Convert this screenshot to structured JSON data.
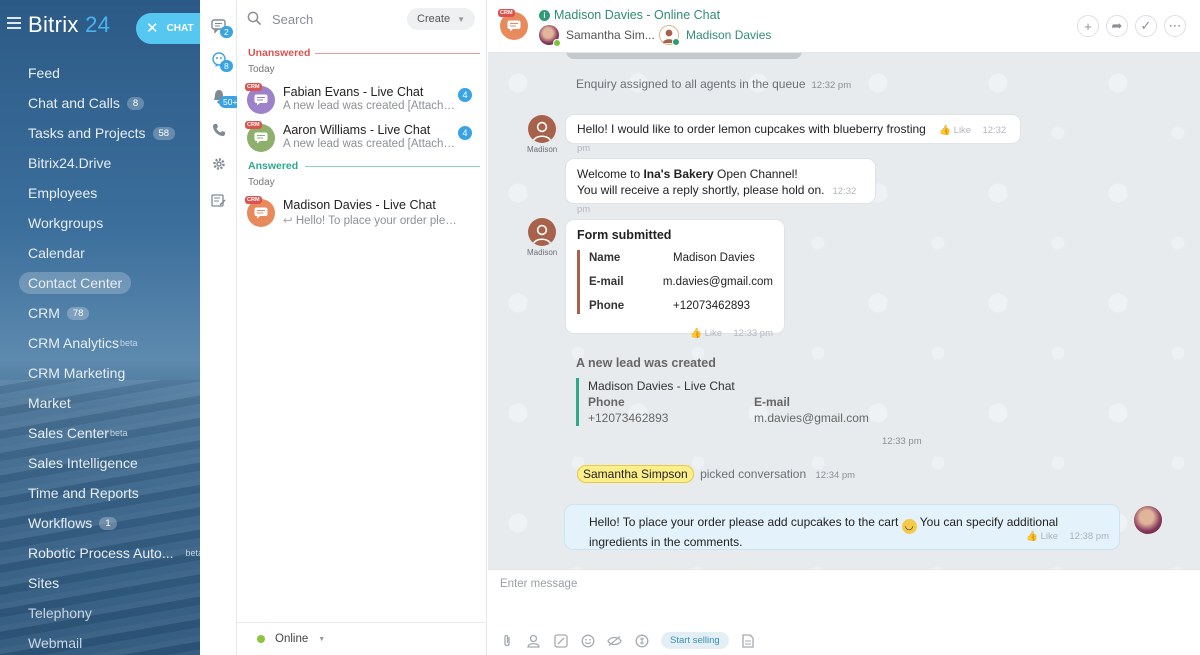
{
  "brand": {
    "name": "Bitrix",
    "number": "24"
  },
  "chat_button": "CHAT",
  "menu": [
    {
      "label": "Feed"
    },
    {
      "label": "Chat and Calls",
      "count": "8"
    },
    {
      "label": "Tasks and Projects",
      "count": "58"
    },
    {
      "label": "Bitrix24.Drive"
    },
    {
      "label": "Employees"
    },
    {
      "label": "Workgroups"
    },
    {
      "label": "Calendar"
    },
    {
      "label": "Contact Center"
    },
    {
      "label": "CRM",
      "count": "78"
    },
    {
      "label": "CRM Analytics",
      "sup": "beta"
    },
    {
      "label": "CRM Marketing"
    },
    {
      "label": "Market"
    },
    {
      "label": "Sales Center",
      "sup": "beta"
    },
    {
      "label": "Sales Intelligence"
    },
    {
      "label": "Time and Reports"
    },
    {
      "label": "Workflows",
      "count": "1"
    },
    {
      "label": "Robotic Process Auto...",
      "sup": "beta"
    },
    {
      "label": "Sites"
    },
    {
      "label": "Telephony"
    },
    {
      "label": "Webmail"
    }
  ],
  "rail": {
    "chats_badge": "2",
    "openlines_badge": "8",
    "notify_badge": "50+"
  },
  "recent": {
    "search_placeholder": "Search",
    "create_label": "Create",
    "unanswered_label": "Unanswered",
    "answered_label": "Answered",
    "today_label": "Today",
    "crm_tag": "CRM",
    "items": [
      {
        "name": "Fabian Evans - Live Chat",
        "snippet": "A new lead was created [Attachm...",
        "count": "4"
      },
      {
        "name": "Aaron Williams - Live Chat",
        "snippet": "A new lead was created [Attachm...",
        "count": "4"
      },
      {
        "name": "Madison Davies - Live Chat",
        "snippet": "Hello! To place your order please ..."
      }
    ],
    "status": "Online"
  },
  "header": {
    "title": "Madison Davies - Online Chat",
    "operator": "Samantha Sim...",
    "client": "Madison Davies"
  },
  "messages": {
    "queue_text": "Enquiry assigned to all agents in the queue",
    "queue_time": "12:32 pm",
    "client_caption": "Madison",
    "msg1": "Hello! I would like to order lemon cupcakes with blueberry frosting",
    "msg1_like": "Like",
    "msg1_time": "12:32 pm",
    "welcome_pre": "Welcome to ",
    "welcome_bold": "Ina's Bakery",
    "welcome_post": " Open Channel!",
    "welcome_line2": "You will receive a reply shortly, please hold on.",
    "welcome_time": "12:32 pm",
    "form_title": "Form submitted",
    "form": [
      {
        "key": "Name",
        "value": "Madison Davies"
      },
      {
        "key": "E-mail",
        "value": "m.davies@gmail.com"
      },
      {
        "key": "Phone",
        "value": "+12073462893"
      }
    ],
    "form_like": "Like",
    "form_time": "12:33 pm",
    "lead_title": "A new lead was created",
    "lead_name": "Madison Davies - Live Chat",
    "lead_phone_label": "Phone",
    "lead_phone": "+12073462893",
    "lead_email_label": "E-mail",
    "lead_email": "m.davies@gmail.com",
    "lead_time": "12:33 pm",
    "picked_name": "Samantha Simpson",
    "picked_text": "picked conversation",
    "picked_time": "12:34 pm",
    "reply_1": "Hello! To place your order please add cupcakes to the cart",
    "reply_2": " You can specify additional",
    "reply_3": "ingredients in the comments.",
    "reply_like": "Like",
    "reply_time": "12:38 pm"
  },
  "composer": {
    "placeholder": "Enter message",
    "start_selling": "Start selling"
  },
  "colors": {
    "accent": "#55c7f0",
    "badge": "#3aa3e3",
    "crm_tag": "#d9534f",
    "openline_green": "#2f8f6f",
    "unanswered": "#d9534f",
    "answered": "#2fa98c"
  }
}
